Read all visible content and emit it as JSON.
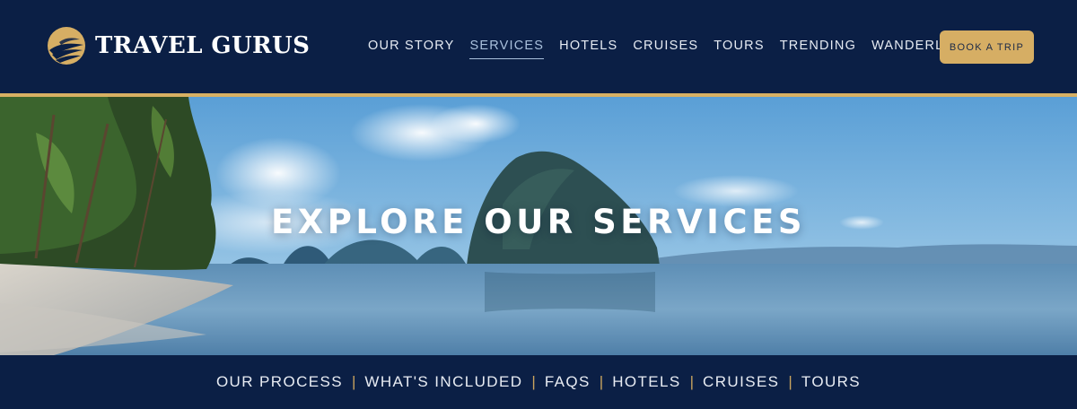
{
  "brand": {
    "name": "TRAVEL GURUS"
  },
  "nav": {
    "items": [
      {
        "label": "OUR STORY"
      },
      {
        "label": "SERVICES",
        "active": true
      },
      {
        "label": "HOTELS"
      },
      {
        "label": "CRUISES"
      },
      {
        "label": "TOURS"
      },
      {
        "label": "TRENDING"
      },
      {
        "label": "WANDERLIST"
      }
    ],
    "cta_label": "BOOK A TRIP"
  },
  "hero": {
    "title": "EXPLORE OUR SERVICES"
  },
  "subnav": {
    "items": [
      {
        "label": "OUR PROCESS"
      },
      {
        "label": "WHAT'S INCLUDED"
      },
      {
        "label": "FAQS"
      },
      {
        "label": "HOTELS"
      },
      {
        "label": "CRUISES"
      },
      {
        "label": "TOURS"
      }
    ],
    "separator": "|"
  },
  "colors": {
    "navy": "#0b1f45",
    "gold": "#d6ae64",
    "active_nav": "#a9c0dc"
  },
  "icons": {
    "logo": "sunset-wings-logo"
  }
}
